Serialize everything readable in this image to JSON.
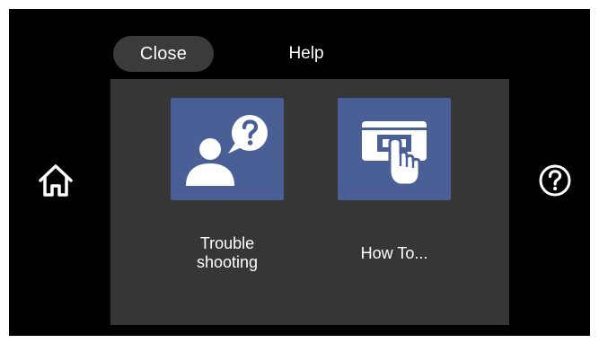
{
  "header": {
    "tabs": [
      {
        "label": "Close",
        "selected": true
      },
      {
        "label": "Help",
        "selected": false
      }
    ]
  },
  "side": {
    "left_icon": "home-icon",
    "right_icon": "question-circle-icon"
  },
  "tiles": [
    {
      "label_line1": "Trouble",
      "label_line2": "shooting",
      "icon": "person-question-icon"
    },
    {
      "label": "How To...",
      "icon": "hand-touch-screen-icon"
    }
  ],
  "colors": {
    "background": "#000000",
    "panel": "#363636",
    "tile": "#4b5f97",
    "tab_selected": "#3b3b3b",
    "text": "#ffffff"
  }
}
